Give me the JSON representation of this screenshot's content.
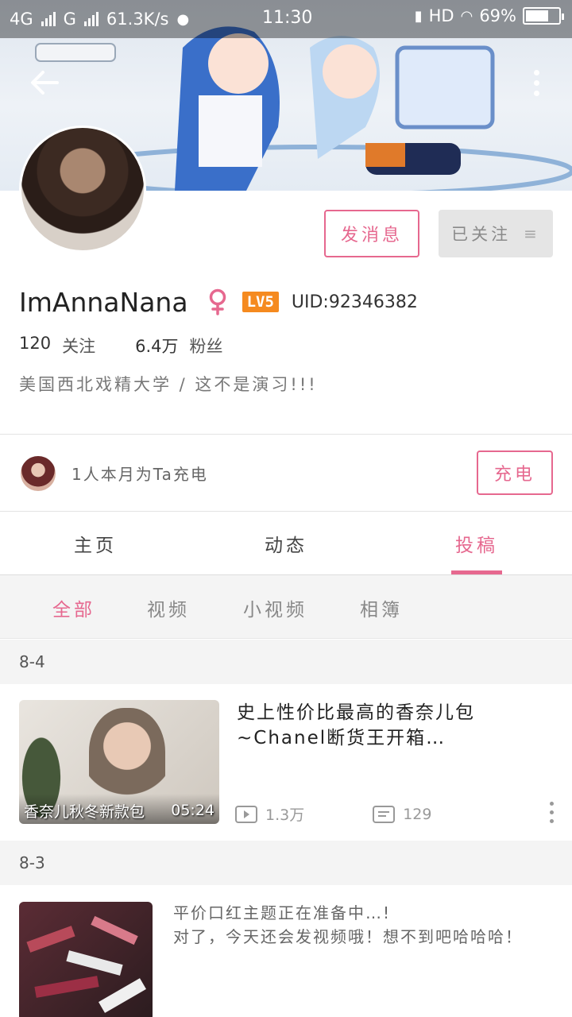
{
  "status_bar": {
    "network1": "4G",
    "network2": "G",
    "speed": "61.3K/s",
    "time": "11:30",
    "hd": "HD",
    "battery": "69%",
    "battery_level": 0.69
  },
  "profile": {
    "username": "ImAnnaNana",
    "level": "LV5",
    "uid": "UID:92346382",
    "following_count": "120",
    "following_label": "关注",
    "fans_count": "6.4万",
    "fans_label": "粉丝",
    "bio": "美国西北戏精大学 / 这不是演习!!!"
  },
  "actions": {
    "message_label": "发消息",
    "followed_label": "已关注"
  },
  "charge": {
    "text": "1人本月为Ta充电",
    "button_label": "充电"
  },
  "tabs": [
    {
      "label": "主页",
      "active": false
    },
    {
      "label": "动态",
      "active": false
    },
    {
      "label": "投稿",
      "active": true
    }
  ],
  "filters": [
    {
      "label": "全部",
      "active": true
    },
    {
      "label": "视频",
      "active": false
    },
    {
      "label": "小视频",
      "active": false
    },
    {
      "label": "相簿",
      "active": false
    }
  ],
  "posts": [
    {
      "date": "8-4",
      "type": "video",
      "title": "史上性价比最高的香奈儿包~Chanel断货王开箱…",
      "thumb_caption": "香奈儿秋冬新款包",
      "duration": "05:24",
      "views": "1.3万",
      "comments": "129"
    },
    {
      "date": "8-3",
      "type": "text",
      "text_line1": "平价口红主题正在准备中…!",
      "text_line2": "对了，今天还会发视频哦！想不到吧哈哈哈！"
    }
  ],
  "colors": {
    "accent": "#e6688f",
    "level_badge": "#f58a1f"
  }
}
